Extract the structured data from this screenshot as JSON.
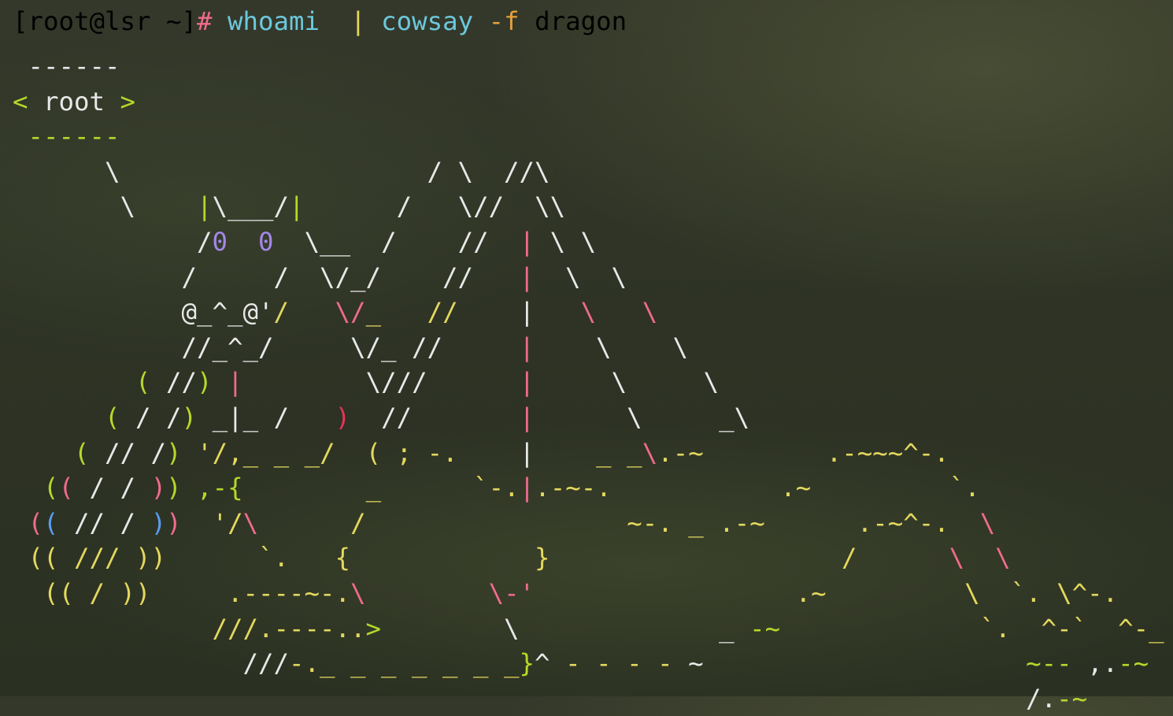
{
  "palette": {
    "default": "#e8e8e8",
    "pink": "#f06b8e",
    "cyan": "#6cc8dc",
    "orange": "#e3a13e",
    "lime": "#b6d82a",
    "yellow": "#e3d85e",
    "purple": "#a487ea",
    "red": "#e8345a",
    "blue": "#5a9cf5"
  },
  "terminal": {
    "prompt": {
      "user_host": "[root@lsr ~]",
      "symbol": "#",
      "command": "whoami",
      "pipe": "|",
      "program": "cowsay",
      "flag": "-f",
      "argument": "dragon"
    },
    "output_lines": [
      [
        {
          "t": " ------"
        }
      ],
      [
        {
          "t": "<",
          "c": "lime"
        },
        {
          "t": " root "
        },
        {
          "t": ">",
          "c": "lime"
        }
      ],
      [
        {
          "t": " ------",
          "c": "lime"
        }
      ],
      [
        {
          "t": "      \\                    / \\  //\\"
        }
      ],
      [
        {
          "t": "       \\    "
        },
        {
          "t": "|",
          "c": "lime"
        },
        {
          "t": "\\___/"
        },
        {
          "t": "|",
          "c": "lime"
        },
        {
          "t": "      /   \\//  \\\\"
        }
      ],
      [
        {
          "t": "            /"
        },
        {
          "t": "0",
          "c": "purple"
        },
        {
          "t": "  "
        },
        {
          "t": "0",
          "c": "purple"
        },
        {
          "t": "  \\__  /    //  "
        },
        {
          "t": "|",
          "c": "pink"
        },
        {
          "t": " \\ \\"
        }
      ],
      [
        {
          "t": "           /     /  \\/_/    //   "
        },
        {
          "t": "|",
          "c": "pink"
        },
        {
          "t": "  \\  \\"
        }
      ],
      [
        {
          "t": "           @_^_@'"
        },
        {
          "t": "/",
          "c": "yellow"
        },
        {
          "t": "   "
        },
        {
          "t": "\\/",
          "c": "pink"
        },
        {
          "t": "_",
          "c": "yellow"
        },
        {
          "t": "   "
        },
        {
          "t": "//",
          "c": "yellow"
        },
        {
          "t": "    "
        },
        {
          "t": "|",
          "c": "default"
        },
        {
          "t": "   "
        },
        {
          "t": "\\",
          "c": "pink"
        },
        {
          "t": "   "
        },
        {
          "t": "\\",
          "c": "pink"
        }
      ],
      [
        {
          "t": "           //_^_/     \\/_ //     "
        },
        {
          "t": "|",
          "c": "pink"
        },
        {
          "t": "    \\    \\"
        }
      ],
      [
        {
          "t": "        "
        },
        {
          "t": "(",
          "c": "lime"
        },
        {
          "t": " //"
        },
        {
          "t": ")",
          "c": "lime"
        },
        {
          "t": " "
        },
        {
          "t": "|",
          "c": "pink"
        },
        {
          "t": "        \\///      "
        },
        {
          "t": "|",
          "c": "pink"
        },
        {
          "t": "     \\     \\"
        }
      ],
      [
        {
          "t": "      "
        },
        {
          "t": "(",
          "c": "lime"
        },
        {
          "t": " / /"
        },
        {
          "t": ")",
          "c": "lime"
        },
        {
          "t": " _|_ /   "
        },
        {
          "t": ")",
          "c": "red"
        },
        {
          "t": "  //       "
        },
        {
          "t": "|",
          "c": "pink"
        },
        {
          "t": "      \\     _\\"
        }
      ],
      [
        {
          "t": "    "
        },
        {
          "t": "(",
          "c": "lime"
        },
        {
          "t": " // /"
        },
        {
          "t": ")",
          "c": "lime"
        },
        {
          "t": " "
        },
        {
          "t": "'/,_ _ _/",
          "c": "yellow"
        },
        {
          "t": "  "
        },
        {
          "t": "( ; -.",
          "c": "yellow"
        },
        {
          "t": "    "
        },
        {
          "t": "|",
          "c": "default"
        },
        {
          "t": "    "
        },
        {
          "t": "_ _",
          "c": "yellow"
        },
        {
          "t": "\\",
          "c": "pink"
        },
        {
          "t": ".-~",
          "c": "yellow"
        },
        {
          "t": "        "
        },
        {
          "t": ".-~~~^-.",
          "c": "yellow"
        }
      ],
      [
        {
          "t": "  "
        },
        {
          "t": "(",
          "c": "lime"
        },
        {
          "t": "(",
          "c": "pink"
        },
        {
          "t": " / / "
        },
        {
          "t": ")",
          "c": "pink"
        },
        {
          "t": ")",
          "c": "lime"
        },
        {
          "t": " "
        },
        {
          "t": ",-{",
          "c": "lime"
        },
        {
          "t": "        "
        },
        {
          "t": "_",
          "c": "yellow"
        },
        {
          "t": "      "
        },
        {
          "t": "`-.",
          "c": "yellow"
        },
        {
          "t": "|",
          "c": "pink"
        },
        {
          "t": ".-~-.",
          "c": "yellow"
        },
        {
          "t": "           "
        },
        {
          "t": ".~",
          "c": "yellow"
        },
        {
          "t": "         "
        },
        {
          "t": "`.",
          "c": "yellow"
        }
      ],
      [
        {
          "t": " "
        },
        {
          "t": "(",
          "c": "pink"
        },
        {
          "t": "(",
          "c": "blue"
        },
        {
          "t": " // / "
        },
        {
          "t": ")",
          "c": "blue"
        },
        {
          "t": ")",
          "c": "pink"
        },
        {
          "t": "  "
        },
        {
          "t": "'/",
          "c": "yellow"
        },
        {
          "t": "\\",
          "c": "pink"
        },
        {
          "t": "      "
        },
        {
          "t": "/",
          "c": "yellow"
        },
        {
          "t": "                 "
        },
        {
          "t": "~-. _ .-~",
          "c": "yellow"
        },
        {
          "t": "      "
        },
        {
          "t": ".-~^-.",
          "c": "yellow"
        },
        {
          "t": "  "
        },
        {
          "t": "\\",
          "c": "pink"
        }
      ],
      [
        {
          "t": " (( /// ))      ",
          "c": "yellow"
        },
        {
          "t": "`.   {            }",
          "c": "yellow"
        },
        {
          "t": "                   "
        },
        {
          "t": "/",
          "c": "yellow"
        },
        {
          "t": "      "
        },
        {
          "t": "\\  \\",
          "c": "pink"
        }
      ],
      [
        {
          "t": "  (( / ))     ",
          "c": "yellow"
        },
        {
          "t": ".----~-.",
          "c": "yellow"
        },
        {
          "t": "\\",
          "c": "pink"
        },
        {
          "t": "        "
        },
        {
          "t": "\\-'",
          "c": "pink"
        },
        {
          "t": "                 "
        },
        {
          "t": ".~",
          "c": "yellow"
        },
        {
          "t": "         "
        },
        {
          "t": "\\  `. \\^-.",
          "c": "yellow"
        }
      ],
      [
        {
          "t": "             ///.----..",
          "c": "yellow"
        },
        {
          "t": ">",
          "c": "lime"
        },
        {
          "t": "        \\             _ "
        },
        {
          "t": "-~",
          "c": "lime"
        },
        {
          "t": "             "
        },
        {
          "t": "`.  ^-`  ^-_",
          "c": "yellow"
        }
      ],
      [
        {
          "t": "               ///"
        },
        {
          "t": "-._ _ _ _ _ _ _",
          "c": "yellow"
        },
        {
          "t": "}",
          "c": "lime"
        },
        {
          "t": "^ "
        },
        {
          "t": "- - - -",
          "c": "yellow"
        },
        {
          "t": " ~                     "
        },
        {
          "t": "~--",
          "c": "lime"
        },
        {
          "t": " ,."
        },
        {
          "t": "-~",
          "c": "lime"
        }
      ],
      [
        {
          "t": "                                                                  /."
        },
        {
          "t": "-~",
          "c": "lime"
        }
      ]
    ]
  }
}
